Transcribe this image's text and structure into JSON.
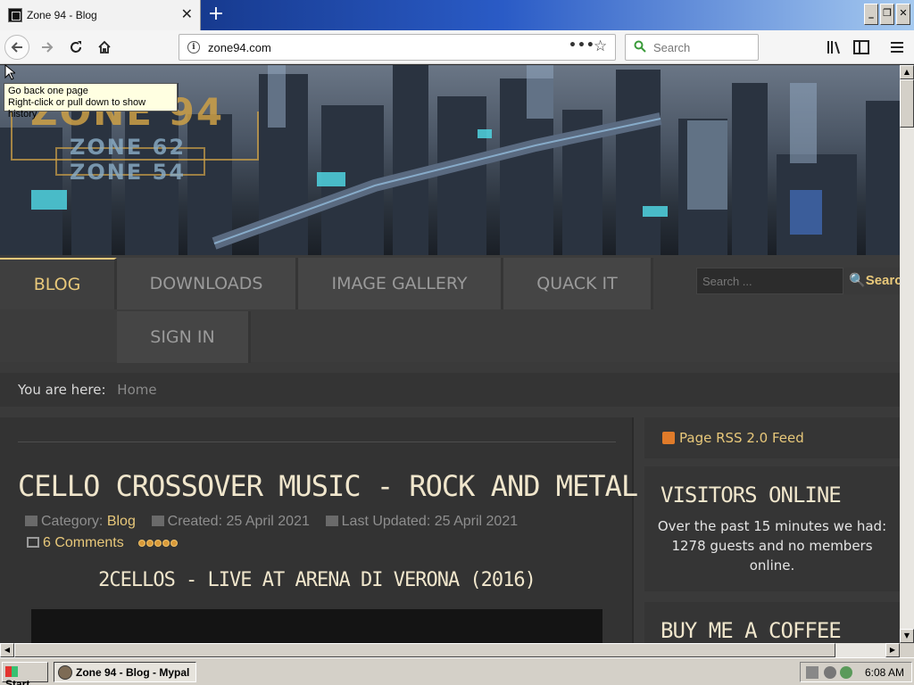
{
  "browser": {
    "tab_title": "Zone 94 - Blog",
    "tab_close": "✕",
    "new_tab": "+",
    "url": "zone94.com",
    "page_actions": "•••",
    "bookmark_star": "☆",
    "search_placeholder": "Search",
    "window_buttons": [
      "_",
      "❐",
      "✕"
    ],
    "tooltip_line1": "Go back one page",
    "tooltip_line2": "Right-click or pull down to show history"
  },
  "site": {
    "logo_primary": "ZONE 94",
    "logo_secondary": "ZONE 62",
    "logo_tertiary": "ZONE 54",
    "menu": [
      {
        "label": "BLOG",
        "active": true
      },
      {
        "label": "DOWNLOADS",
        "active": false
      },
      {
        "label": "IMAGE GALLERY",
        "active": false
      },
      {
        "label": "QUACK IT",
        "active": false
      },
      {
        "label": "SIGN IN",
        "active": false
      }
    ],
    "search_placeholder": "Search ...",
    "search_button": "Search",
    "breadcrumb_label": "You are here:",
    "breadcrumb_home": "Home"
  },
  "article": {
    "title": "CELLO CROSSOVER MUSIC - ROCK AND METAL",
    "category_label": "Category:",
    "category": "Blog",
    "created": "Created: 25 April 2021",
    "updated": "Last Updated: 25 April 2021",
    "comments": "6 Comments",
    "rating_stars": 5,
    "video_title": "2CELLOS - LIVE AT ARENA DI VERONA (2016)"
  },
  "sidebar": {
    "rss": "Page RSS 2.0 Feed",
    "visitors_title": "VISITORS ONLINE",
    "visitors_text": "Over the past 15 minutes we had: 1278 guests and no members online.",
    "coffee_title": "BUY ME A COFFEE"
  },
  "taskbar": {
    "start": "Start",
    "task": "Zone 94 - Blog - Mypal",
    "time": "6:08 AM"
  },
  "colors": {
    "accent_gold": "#e8c87a",
    "page_bg": "#3a3a3a"
  }
}
